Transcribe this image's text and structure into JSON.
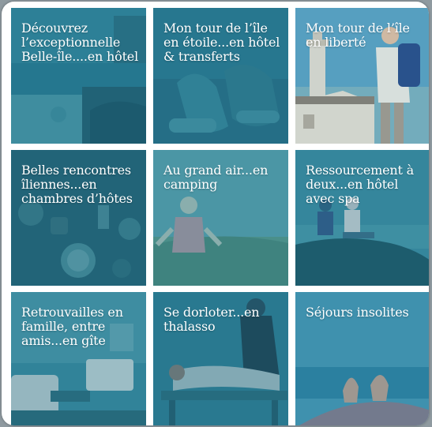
{
  "colors": {
    "tint": "#1f6f86",
    "tint_light": "#3f97a8",
    "background": "#ffffff"
  },
  "tiles": [
    {
      "id": "hotel",
      "label": "Découvrez l’exceptionnelle Belle-île....en hôtel"
    },
    {
      "id": "etoile",
      "label": "Mon tour de l’île en étoile...en hôtel & transferts"
    },
    {
      "id": "liberte",
      "label": "Mon tour de l’île en liberté"
    },
    {
      "id": "chambres",
      "label": "Belles rencontres îliennes...en chambres d’hôtes"
    },
    {
      "id": "camping",
      "label": "Au grand air...en camping"
    },
    {
      "id": "spa",
      "label": "Ressourcement à deux...en hôtel avec spa"
    },
    {
      "id": "gite",
      "label": "Retrouvailles en famille, entre amis...en gîte"
    },
    {
      "id": "thalasso",
      "label": "Se dorloter...en thalasso"
    },
    {
      "id": "insolites",
      "label": "Séjours insolites"
    }
  ]
}
